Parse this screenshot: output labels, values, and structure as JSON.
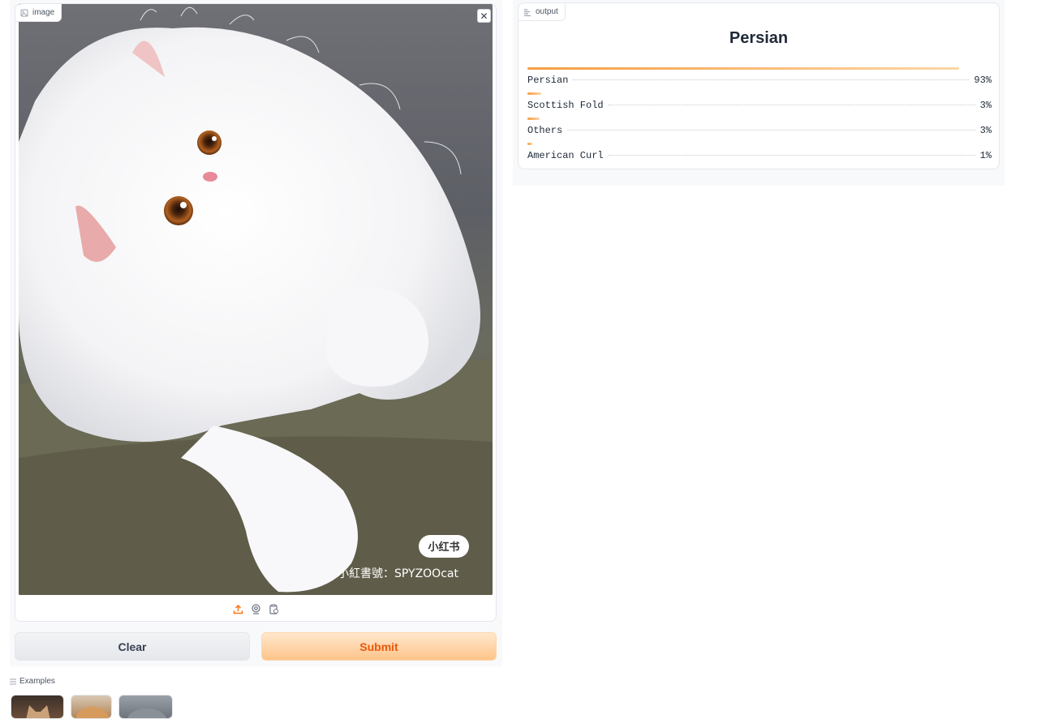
{
  "input": {
    "label": "image",
    "close_glyph": "✕",
    "watermark_badge": "小红书",
    "watermark_text": "小紅書號：SPYZOOcat",
    "toolbar_icons": [
      "upload-icon",
      "webcam-icon",
      "clipboard-icon"
    ]
  },
  "buttons": {
    "clear": "Clear",
    "submit": "Submit"
  },
  "examples": {
    "label": "Examples"
  },
  "output": {
    "label": "output",
    "title": "Persian",
    "confidences": [
      {
        "label": "Persian",
        "value_text": "93%",
        "value": 0.93
      },
      {
        "label": "Scottish Fold",
        "value_text": "3%",
        "value": 0.03
      },
      {
        "label": "Others",
        "value_text": "3%",
        "value": 0.03
      },
      {
        "label": "American Curl",
        "value_text": "1%",
        "value": 0.01
      }
    ]
  },
  "colors": {
    "accent": "#f97316",
    "bar_start": "#f59e42",
    "bar_end": "#fdd6a6",
    "submit_text": "#ea580c"
  }
}
